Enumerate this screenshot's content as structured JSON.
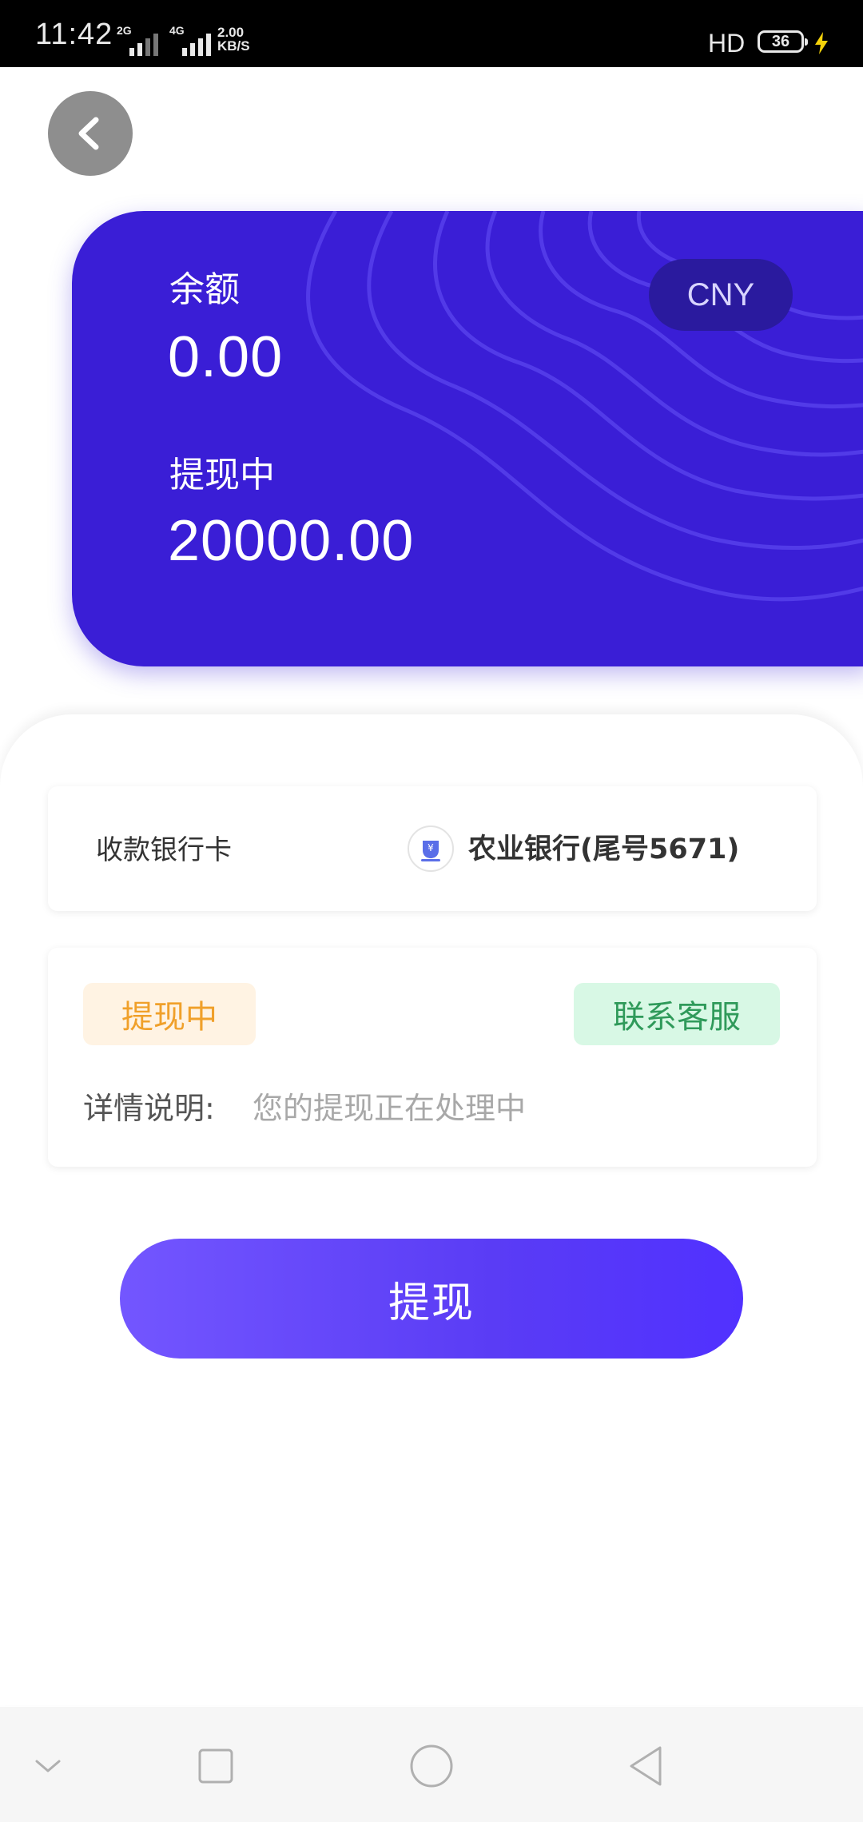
{
  "status_bar": {
    "time": "11:42",
    "sim1_tech": "2G",
    "sim2_tech": "4G",
    "net_speed_value": "2.00",
    "net_speed_unit": "KB/S",
    "hd_label": "HD",
    "battery_level": "36",
    "icons": [
      "signal-icon",
      "signal-icon",
      "charging-bolt-icon"
    ]
  },
  "header": {
    "back_icon": "chevron-left-icon"
  },
  "balance_card": {
    "balance_label": "余额",
    "balance_value": "0.00",
    "withdrawing_label": "提现中",
    "withdrawing_value": "20000.00",
    "currency": "CNY",
    "colors": {
      "card": "#3a1ed6",
      "currency_badge": "#2a1a9e"
    }
  },
  "bank_row": {
    "label": "收款银行卡",
    "bank_name": "农业银行(尾号5671)",
    "bank_icon": "bank-logo-icon"
  },
  "status_card": {
    "status_badge": "提现中",
    "contact_button": "联系客服",
    "detail_label": "详情说明:",
    "detail_text": "您的提现正在处理中",
    "colors": {
      "status_text": "#f0a02a",
      "status_bg": "#fff3e3",
      "contact_text": "#2f9a5a",
      "contact_bg": "#d8f8e5"
    }
  },
  "withdraw_button": {
    "label": "提现",
    "color_start": "#7356ff",
    "color_end": "#5131ff"
  },
  "nav_bar": {
    "icons": [
      "chevron-down-icon",
      "square-icon",
      "circle-icon",
      "triangle-back-icon"
    ]
  }
}
